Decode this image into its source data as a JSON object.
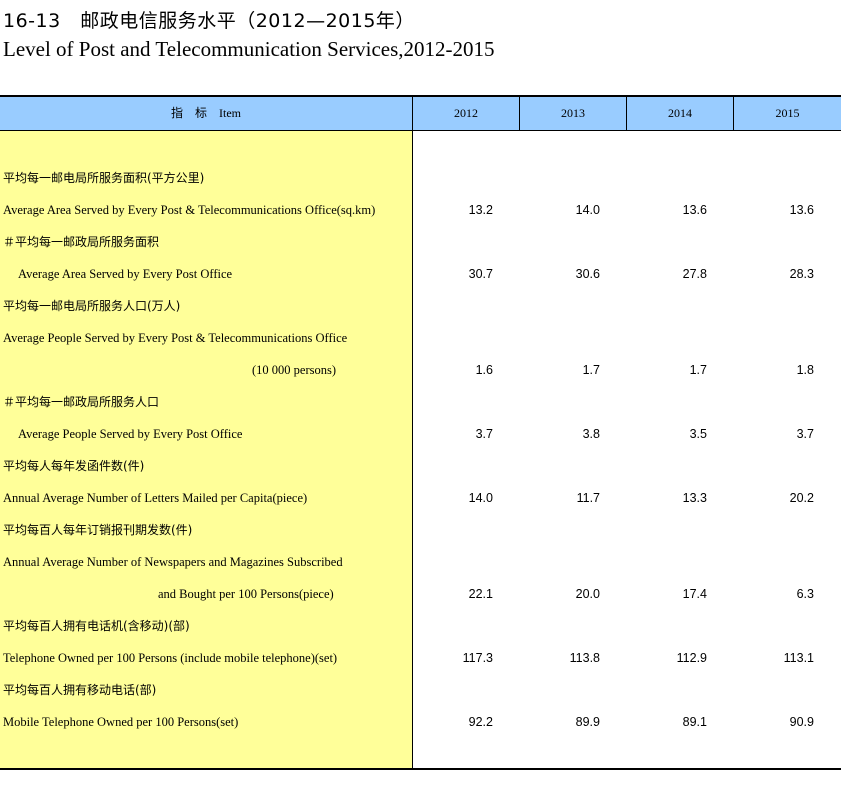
{
  "title_zh": "16-13　邮政电信服务水平（2012—2015年）",
  "title_en": "Level of Post and Telecommunication Services,2012-2015",
  "header": {
    "item": "指　标　Item",
    "years": [
      "2012",
      "2013",
      "2014",
      "2015"
    ]
  },
  "rows": [
    {
      "zh": "平均每一邮电局所服务面积(平方公里)"
    },
    {
      "en": "Average Area Served by Every Post & Telecommunications Office(sq.km)",
      "values": [
        "13.2",
        "14.0",
        "13.6",
        "13.6"
      ]
    },
    {
      "zh": "＃平均每一邮政局所服务面积"
    },
    {
      "en": "Average Area Served by Every Post Office",
      "values": [
        "30.7",
        "30.6",
        "27.8",
        "28.3"
      ]
    },
    {
      "zh": "平均每一邮电局所服务人口(万人)"
    },
    {
      "en": "Average People Served by Every Post & Telecommunications Office"
    },
    {
      "en": "(10 000 persons)",
      "values": [
        "1.6",
        "1.7",
        "1.7",
        "1.8"
      ]
    },
    {
      "zh": "＃平均每一邮政局所服务人口"
    },
    {
      "en": "Average People Served by Every Post Office",
      "values": [
        "3.7",
        "3.8",
        "3.5",
        "3.7"
      ]
    },
    {
      "zh": "平均每人每年发函件数(件)"
    },
    {
      "en": "Annual Average Number of Letters Mailed per Capita(piece)",
      "values": [
        "14.0",
        "11.7",
        "13.3",
        "20.2"
      ]
    },
    {
      "zh": "平均每百人每年订销报刊期发数(件)"
    },
    {
      "en": "Annual Average Number of Newspapers and Magazines Subscribed"
    },
    {
      "en": "and Bought per 100 Persons(piece)",
      "values": [
        "22.1",
        "20.0",
        "17.4",
        "6.3"
      ]
    },
    {
      "zh": "平均每百人拥有电话机(含移动)(部)"
    },
    {
      "en": "Telephone Owned per 100 Persons (include mobile telephone)(set)",
      "values": [
        "117.3",
        "113.8",
        "112.9",
        "113.1"
      ]
    },
    {
      "zh": "平均每百人拥有移动电话(部)"
    },
    {
      "en": "Mobile Telephone Owned per 100 Persons(set)",
      "values": [
        "92.2",
        "89.9",
        "89.1",
        "90.9"
      ]
    }
  ]
}
